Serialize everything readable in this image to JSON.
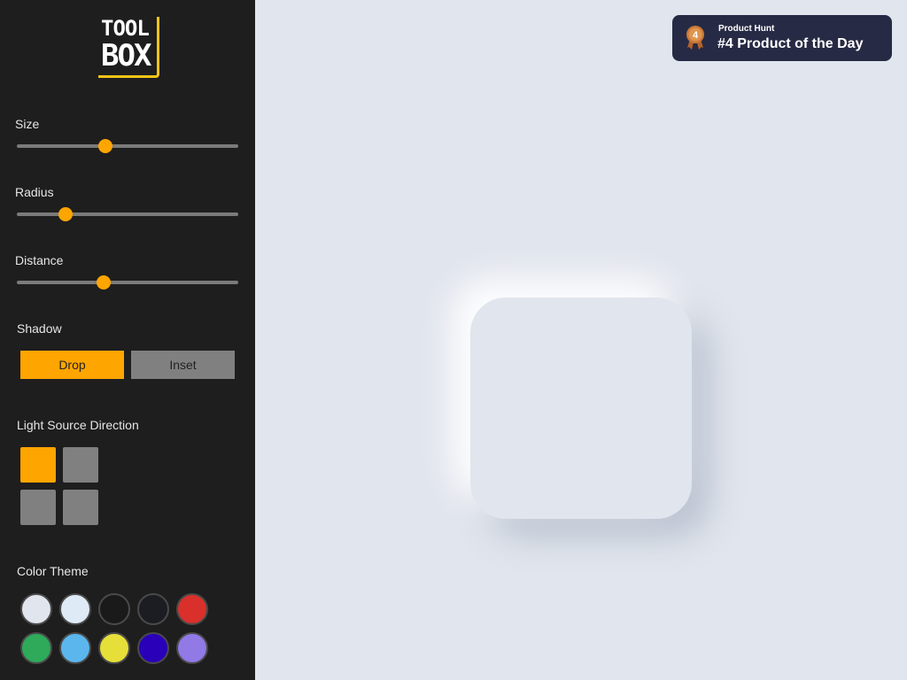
{
  "logo": {
    "line1": "TOOL",
    "line2": "BOX"
  },
  "controls": {
    "size": {
      "label": "Size",
      "value_fraction": 0.4
    },
    "radius": {
      "label": "Radius",
      "value_fraction": 0.22
    },
    "distance": {
      "label": "Distance",
      "value_fraction": 0.39
    }
  },
  "shadow": {
    "label": "Shadow",
    "drop_label": "Drop",
    "inset_label": "Inset",
    "selected": "Drop"
  },
  "light_source": {
    "label": "Light Source Direction",
    "selected": "top-left"
  },
  "color_theme": {
    "label": "Color Theme",
    "swatches": [
      "#e1e5ed",
      "#dfeaf7",
      "#1a1a1a",
      "#1c1d22",
      "#d9302c",
      "#2eaa5a",
      "#5bb6ee",
      "#e6df3a",
      "#2a00b8",
      "#9179e6"
    ]
  },
  "product_hunt": {
    "small_text": "Product Hunt",
    "big_text": "#4 Product of the Day",
    "medal_number": "4"
  },
  "colors": {
    "accent": "#ffa500",
    "sidebar": "#1e1e1e",
    "background": "#e1e5ed"
  }
}
